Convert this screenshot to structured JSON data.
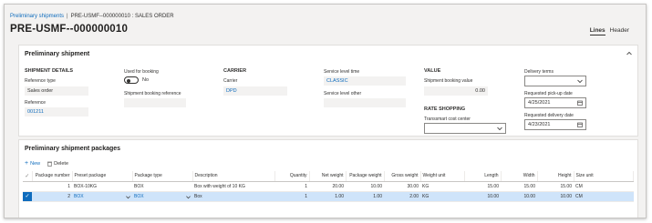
{
  "breadcrumb": {
    "parent": "Preliminary shipments",
    "separator": "|",
    "current": "PRE-USMF--000000010 : SALES ORDER"
  },
  "page_title": "PRE-USMF--000000010",
  "view_tabs": [
    {
      "label": "Lines",
      "active": true
    },
    {
      "label": "Header",
      "active": false
    }
  ],
  "shipment": {
    "title": "Preliminary shipment",
    "details_header": "SHIPMENT DETAILS",
    "reference_type_label": "Reference type",
    "reference_type_value": "Sales order",
    "reference_label": "Reference",
    "reference_value": "001211",
    "used_for_booking_label": "Used for booking",
    "used_for_booking_value": "No",
    "booking_reference_label": "Shipment booking reference",
    "carrier_header": "CARRIER",
    "carrier_label": "Carrier",
    "carrier_value": "DPD",
    "service_level_label": "Service level time",
    "service_level_value": "CLASSIC",
    "service_level_other_label": "Service level other",
    "value_header": "VALUE",
    "booking_value_label": "Shipment booking value",
    "booking_value_value": "0.00",
    "rate_header": "RATE SHOPPING",
    "cost_center_label": "Transsmart cost center",
    "delivery_terms_label": "Delivery terms",
    "pickup_date_label": "Requested pick-up date",
    "pickup_date_value": "4/25/2021",
    "delivery_date_label": "Requested delivery date",
    "delivery_date_value": "4/23/2021"
  },
  "packages": {
    "title": "Preliminary shipment packages",
    "new_label": "New",
    "delete_label": "Delete",
    "columns": [
      "Package number",
      "Preset package",
      "Package type",
      "Description",
      "Quantity",
      "Net weight",
      "Package weight",
      "Gross weight",
      "Weight unit",
      "Length",
      "Width",
      "Height",
      "Size unit"
    ],
    "rows": [
      [
        "1",
        "BOX-10KG",
        "BOX",
        "Box with weight of 10 KG",
        "1",
        "20.00",
        "10.00",
        "30.00",
        "KG",
        "15.00",
        "15.00",
        "15.00",
        "CM"
      ],
      [
        "2",
        "BOX",
        "BOX",
        "Box",
        "1",
        "1.00",
        "1.00",
        "2.00",
        "KG",
        "10.00",
        "10.00",
        "10.00",
        "CM"
      ]
    ]
  },
  "colors": {
    "accent": "#0f6cbd",
    "selected_row": "#cfe4fa",
    "background": "#f3f2f1"
  }
}
